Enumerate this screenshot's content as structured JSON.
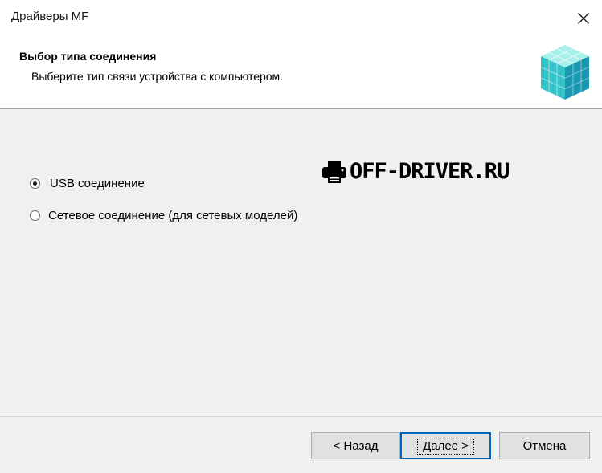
{
  "window": {
    "title": "Драйверы MF"
  },
  "header": {
    "title": "Выбор типа соединения",
    "subtitle": "Выберите тип связи устройства с компьютером."
  },
  "options": [
    {
      "label": "USB соединение",
      "selected": true
    },
    {
      "label": "Сетевое соединение (для сетевых моделей)",
      "selected": false
    }
  ],
  "watermark": {
    "text": "OFF-DRIVER.RU"
  },
  "buttons": {
    "back": "< Назад",
    "next": "Далее >",
    "cancel": "Отмена"
  },
  "icons": {
    "close": "close-icon",
    "logo": "cube-logo-icon",
    "printer": "printer-icon"
  },
  "colors": {
    "accent": "#0067c0",
    "logo_light": "#8ee8e0",
    "logo_mid": "#2fc4c4",
    "logo_dark": "#1690a8"
  }
}
